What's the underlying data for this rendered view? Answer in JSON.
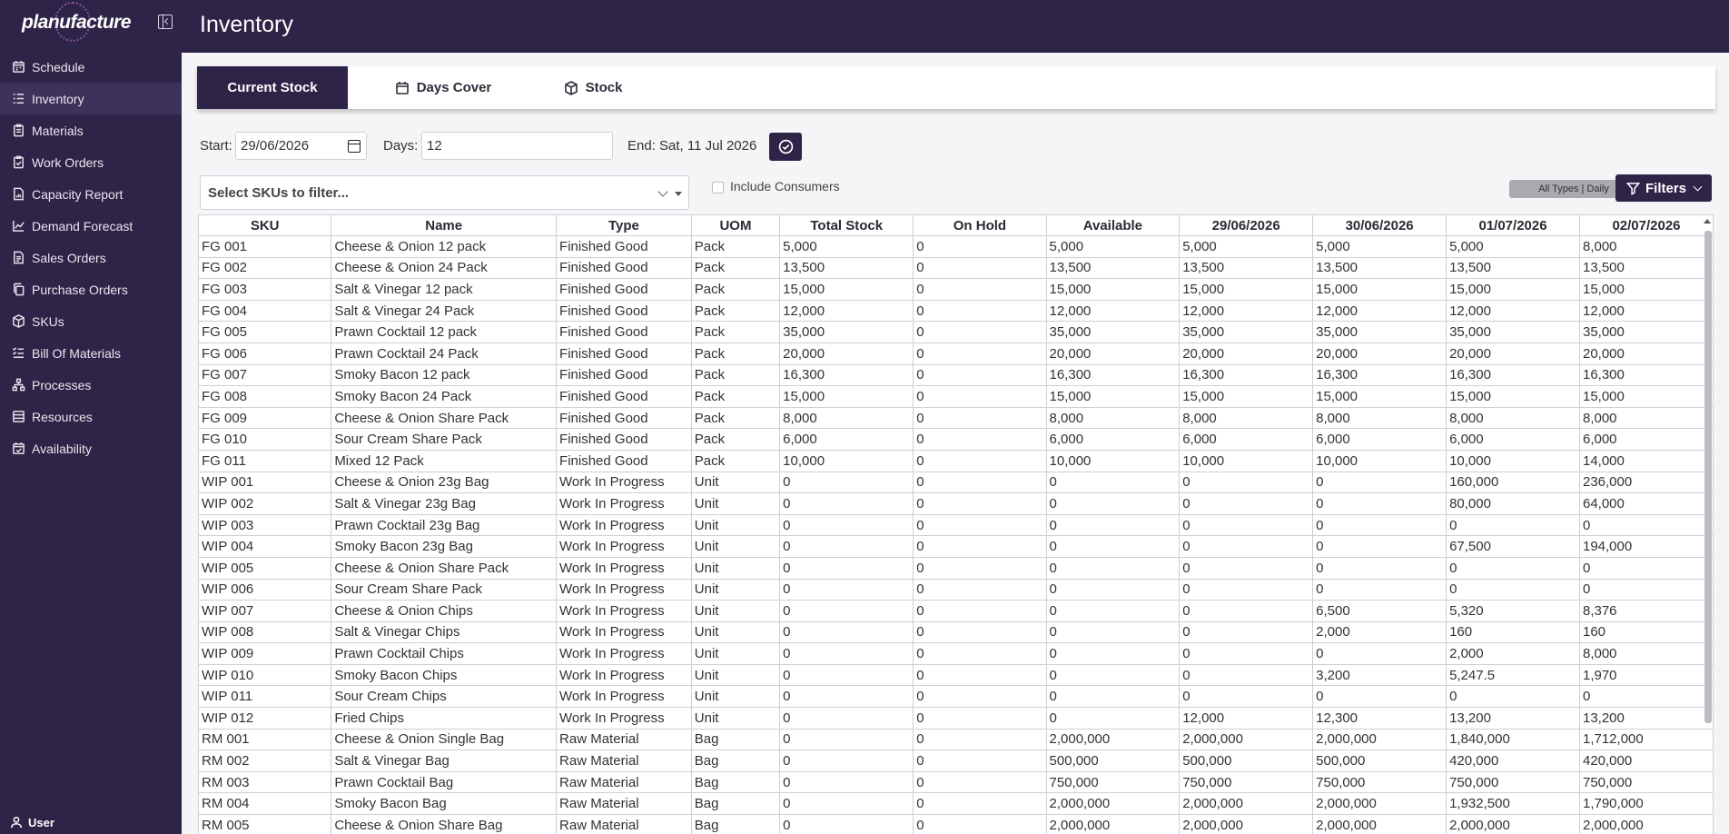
{
  "brand": {
    "logo_text": "planufacture"
  },
  "sidebar": {
    "items": [
      {
        "label": "Schedule",
        "icon": "calendar-icon"
      },
      {
        "label": "Inventory",
        "icon": "list-icon"
      },
      {
        "label": "Materials",
        "icon": "clipboard-icon"
      },
      {
        "label": "Work Orders",
        "icon": "clipboard-check-icon"
      },
      {
        "label": "Capacity Report",
        "icon": "file-chart-icon"
      },
      {
        "label": "Demand Forecast",
        "icon": "line-chart-icon"
      },
      {
        "label": "Sales Orders",
        "icon": "document-icon"
      },
      {
        "label": "Purchase Orders",
        "icon": "copy-icon"
      },
      {
        "label": "SKUs",
        "icon": "box-icon"
      },
      {
        "label": "Bill Of Materials",
        "icon": "list-check-icon"
      },
      {
        "label": "Processes",
        "icon": "workflow-icon"
      },
      {
        "label": "Resources",
        "icon": "layers-icon"
      },
      {
        "label": "Availability",
        "icon": "calendar-check-icon"
      }
    ],
    "active_index": 1,
    "user_label": "User"
  },
  "header": {
    "title": "Inventory"
  },
  "tabs": [
    {
      "label": "Current Stock"
    },
    {
      "label": "Days Cover"
    },
    {
      "label": "Stock"
    }
  ],
  "controls": {
    "start_label": "Start:",
    "start_value": "29/06/2026",
    "days_label": "Days:",
    "days_value": "12",
    "end_text": "End: Sat, 11 Jul 2026",
    "sku_filter_placeholder": "Select SKUs to filter...",
    "include_consumers_label": "Include Consumers",
    "type_badge": "All Types | Daily",
    "filters_label": "Filters"
  },
  "colors": {
    "primary": "#2e2447",
    "grid_border": "#cfcfd6"
  },
  "table": {
    "columns": [
      "SKU",
      "Name",
      "Type",
      "UOM",
      "Total Stock",
      "On Hold",
      "Available",
      "29/06/2026",
      "30/06/2026",
      "01/07/2026",
      "02/07/2026"
    ],
    "rows": [
      [
        "FG 001",
        "Cheese & Onion 12 pack",
        "Finished Good",
        "Pack",
        "5,000",
        "0",
        "5,000",
        "5,000",
        "5,000",
        "5,000",
        "8,000"
      ],
      [
        "FG 002",
        "Cheese & Onion 24 Pack",
        "Finished Good",
        "Pack",
        "13,500",
        "0",
        "13,500",
        "13,500",
        "13,500",
        "13,500",
        "13,500"
      ],
      [
        "FG 003",
        "Salt & Vinegar 12 pack",
        "Finished Good",
        "Pack",
        "15,000",
        "0",
        "15,000",
        "15,000",
        "15,000",
        "15,000",
        "15,000"
      ],
      [
        "FG 004",
        "Salt & Vinegar 24 Pack",
        "Finished Good",
        "Pack",
        "12,000",
        "0",
        "12,000",
        "12,000",
        "12,000",
        "12,000",
        "12,000"
      ],
      [
        "FG 005",
        "Prawn Cocktail 12 pack",
        "Finished Good",
        "Pack",
        "35,000",
        "0",
        "35,000",
        "35,000",
        "35,000",
        "35,000",
        "35,000"
      ],
      [
        "FG 006",
        "Prawn Cocktail 24 Pack",
        "Finished Good",
        "Pack",
        "20,000",
        "0",
        "20,000",
        "20,000",
        "20,000",
        "20,000",
        "20,000"
      ],
      [
        "FG 007",
        "Smoky Bacon 12 pack",
        "Finished Good",
        "Pack",
        "16,300",
        "0",
        "16,300",
        "16,300",
        "16,300",
        "16,300",
        "16,300"
      ],
      [
        "FG 008",
        "Smoky Bacon 24 Pack",
        "Finished Good",
        "Pack",
        "15,000",
        "0",
        "15,000",
        "15,000",
        "15,000",
        "15,000",
        "15,000"
      ],
      [
        "FG 009",
        "Cheese & Onion Share Pack",
        "Finished Good",
        "Pack",
        "8,000",
        "0",
        "8,000",
        "8,000",
        "8,000",
        "8,000",
        "8,000"
      ],
      [
        "FG 010",
        "Sour Cream Share Pack",
        "Finished Good",
        "Pack",
        "6,000",
        "0",
        "6,000",
        "6,000",
        "6,000",
        "6,000",
        "6,000"
      ],
      [
        "FG 011",
        "Mixed 12 Pack",
        "Finished Good",
        "Pack",
        "10,000",
        "0",
        "10,000",
        "10,000",
        "10,000",
        "10,000",
        "14,000"
      ],
      [
        "WIP 001",
        "Cheese & Onion 23g Bag",
        "Work In Progress",
        "Unit",
        "0",
        "0",
        "0",
        "0",
        "0",
        "160,000",
        "236,000"
      ],
      [
        "WIP 002",
        "Salt & Vinegar 23g Bag",
        "Work In Progress",
        "Unit",
        "0",
        "0",
        "0",
        "0",
        "0",
        "80,000",
        "64,000"
      ],
      [
        "WIP 003",
        "Prawn Cocktail 23g Bag",
        "Work In Progress",
        "Unit",
        "0",
        "0",
        "0",
        "0",
        "0",
        "0",
        "0"
      ],
      [
        "WIP 004",
        "Smoky Bacon 23g Bag",
        "Work In Progress",
        "Unit",
        "0",
        "0",
        "0",
        "0",
        "0",
        "67,500",
        "194,000"
      ],
      [
        "WIP 005",
        "Cheese & Onion Share Pack",
        "Work In Progress",
        "Unit",
        "0",
        "0",
        "0",
        "0",
        "0",
        "0",
        "0"
      ],
      [
        "WIP 006",
        "Sour Cream Share Pack",
        "Work In Progress",
        "Unit",
        "0",
        "0",
        "0",
        "0",
        "0",
        "0",
        "0"
      ],
      [
        "WIP 007",
        "Cheese & Onion Chips",
        "Work In Progress",
        "Unit",
        "0",
        "0",
        "0",
        "0",
        "6,500",
        "5,320",
        "8,376"
      ],
      [
        "WIP 008",
        "Salt & Vinegar Chips",
        "Work In Progress",
        "Unit",
        "0",
        "0",
        "0",
        "0",
        "2,000",
        "160",
        "160"
      ],
      [
        "WIP 009",
        "Prawn Cocktail Chips",
        "Work In Progress",
        "Unit",
        "0",
        "0",
        "0",
        "0",
        "0",
        "2,000",
        "8,000"
      ],
      [
        "WIP 010",
        "Smoky Bacon Chips",
        "Work In Progress",
        "Unit",
        "0",
        "0",
        "0",
        "0",
        "3,200",
        "5,247.5",
        "1,970"
      ],
      [
        "WIP 011",
        "Sour Cream Chips",
        "Work In Progress",
        "Unit",
        "0",
        "0",
        "0",
        "0",
        "0",
        "0",
        "0"
      ],
      [
        "WIP 012",
        "Fried Chips",
        "Work In Progress",
        "Unit",
        "0",
        "0",
        "0",
        "12,000",
        "12,300",
        "13,200",
        "13,200"
      ],
      [
        "RM 001",
        "Cheese & Onion Single Bag",
        "Raw Material",
        "Bag",
        "0",
        "0",
        "2,000,000",
        "2,000,000",
        "2,000,000",
        "1,840,000",
        "1,712,000"
      ],
      [
        "RM 002",
        "Salt & Vinegar Bag",
        "Raw Material",
        "Bag",
        "0",
        "0",
        "500,000",
        "500,000",
        "500,000",
        "420,000",
        "420,000"
      ],
      [
        "RM 003",
        "Prawn Cocktail Bag",
        "Raw Material",
        "Bag",
        "0",
        "0",
        "750,000",
        "750,000",
        "750,000",
        "750,000",
        "750,000"
      ],
      [
        "RM 004",
        "Smoky Bacon Bag",
        "Raw Material",
        "Bag",
        "0",
        "0",
        "2,000,000",
        "2,000,000",
        "2,000,000",
        "1,932,500",
        "1,790,000"
      ],
      [
        "RM 005",
        "Cheese & Onion Share Bag",
        "Raw Material",
        "Bag",
        "0",
        "0",
        "2,000,000",
        "2,000,000",
        "2,000,000",
        "2,000,000",
        "2,000,000"
      ]
    ]
  }
}
